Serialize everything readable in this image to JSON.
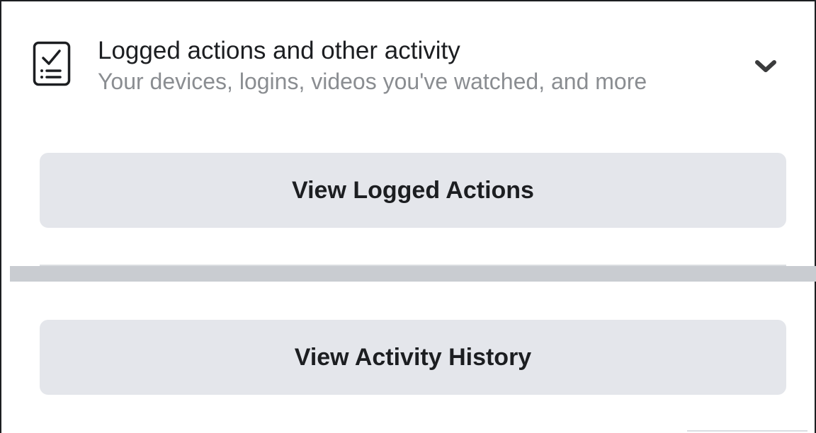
{
  "section": {
    "icon": "checklist-icon",
    "title": "Logged actions and other activity",
    "subtitle": "Your devices, logins, videos you've watched, and more",
    "toggle_icon": "chevron-down-icon"
  },
  "buttons": {
    "view_logged_actions": "View Logged Actions",
    "view_activity_history": "View Activity History"
  },
  "colors": {
    "button_bg": "#e4e6eb",
    "primary_text": "#1c1e21",
    "secondary_text": "#8a8d91",
    "divider": "#c9ccd1"
  }
}
